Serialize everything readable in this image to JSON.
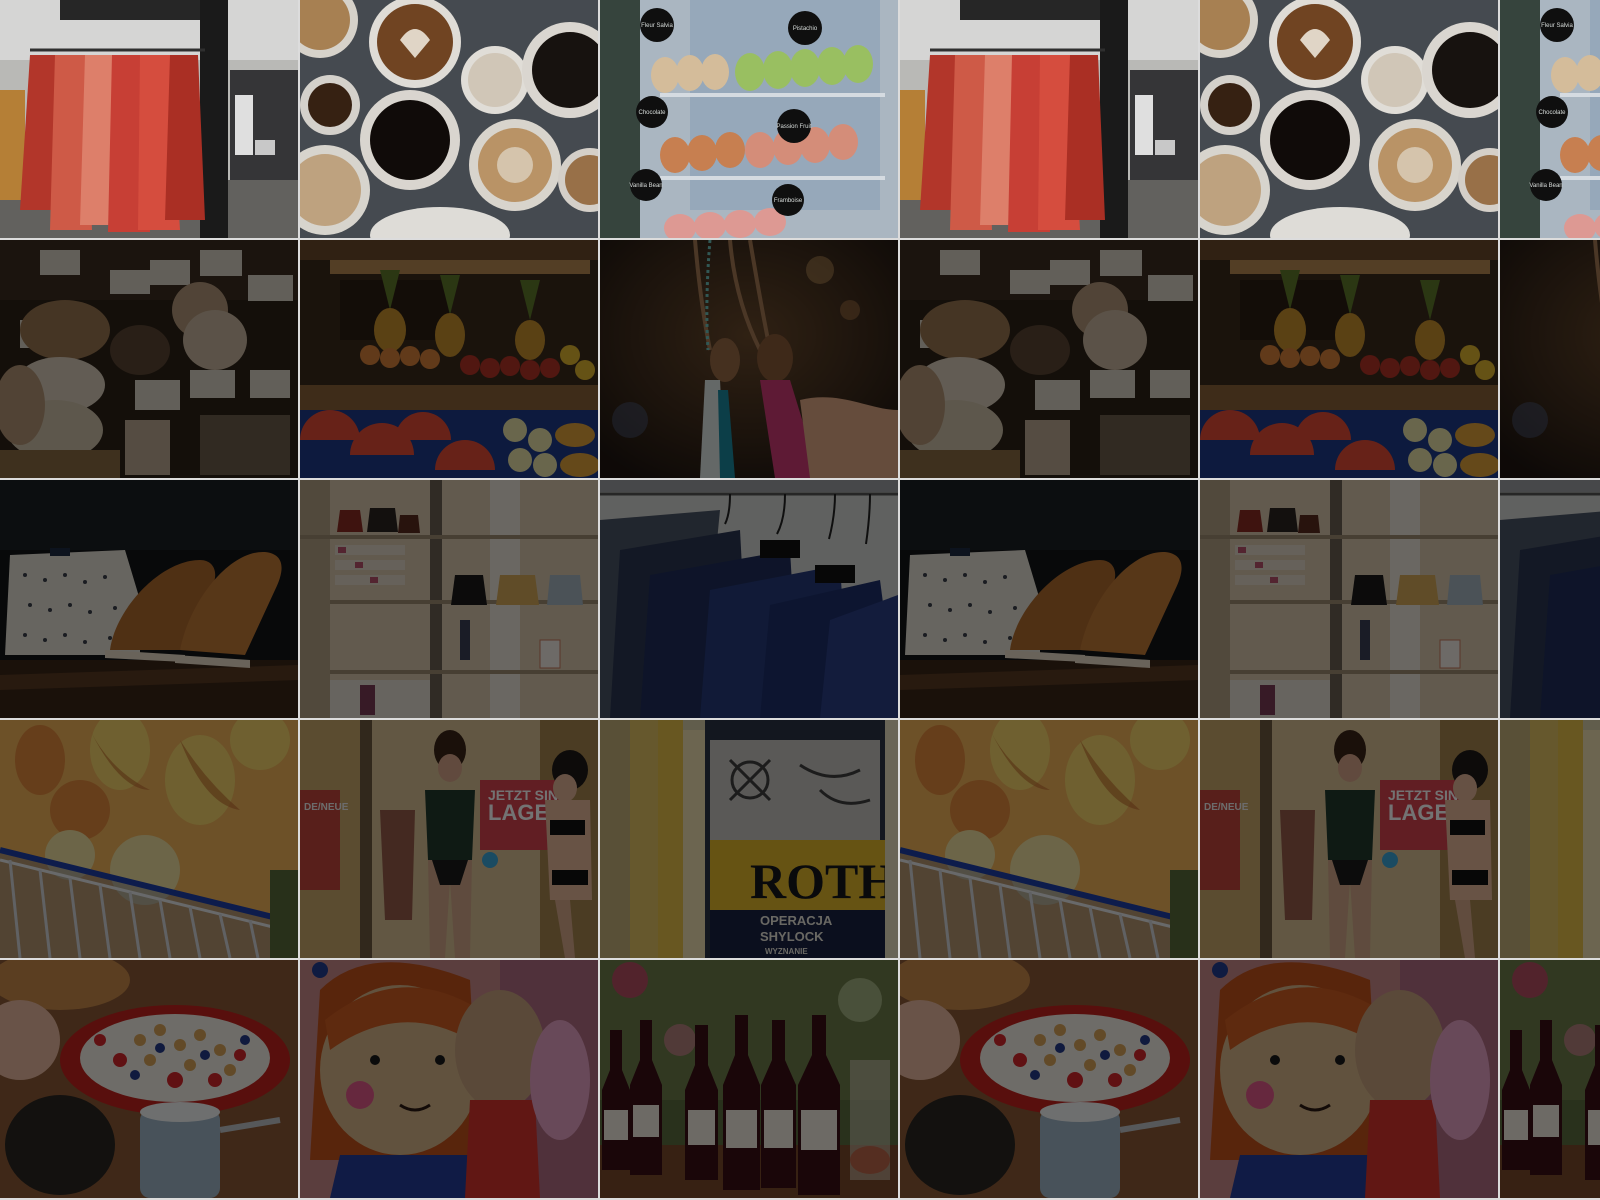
{
  "book_cover": {
    "author": "ROTH",
    "title_line1": "OPERACJA",
    "title_line2": "SHYLOCK",
    "publisher": "WYZNANIE"
  },
  "shop_poster": {
    "line1": "JETZT SIND",
    "line2": "LAGE",
    "line3": "DE/NEUE"
  },
  "macaron_signs": [
    "Fleur Salvia",
    "Pistachio",
    "Chocolate",
    "Passion Fruit",
    "Vanilla Bean",
    "Framboise"
  ],
  "tiles": [
    {
      "row": 0,
      "col": 0,
      "kind": "clothing-rack"
    },
    {
      "row": 0,
      "col": 1,
      "kind": "coffee-cups"
    },
    {
      "row": 0,
      "col": 2,
      "kind": "macarons"
    },
    {
      "row": 0,
      "col": 3,
      "kind": "clothing-rack"
    },
    {
      "row": 0,
      "col": 4,
      "kind": "coffee-cups"
    },
    {
      "row": 0,
      "col": 5,
      "kind": "macarons"
    },
    {
      "row": 1,
      "col": 0,
      "kind": "bread"
    },
    {
      "row": 1,
      "col": 1,
      "kind": "fruit-stand"
    },
    {
      "row": 1,
      "col": 2,
      "kind": "tassels"
    },
    {
      "row": 1,
      "col": 3,
      "kind": "bread"
    },
    {
      "row": 1,
      "col": 4,
      "kind": "fruit-stand"
    },
    {
      "row": 1,
      "col": 5,
      "kind": "tassels"
    },
    {
      "row": 2,
      "col": 0,
      "kind": "shoes"
    },
    {
      "row": 2,
      "col": 1,
      "kind": "bag-shelves"
    },
    {
      "row": 2,
      "col": 2,
      "kind": "suits"
    },
    {
      "row": 2,
      "col": 3,
      "kind": "shoes"
    },
    {
      "row": 2,
      "col": 4,
      "kind": "bag-shelves"
    },
    {
      "row": 2,
      "col": 5,
      "kind": "suits"
    },
    {
      "row": 3,
      "col": 0,
      "kind": "pasta-basket"
    },
    {
      "row": 3,
      "col": 1,
      "kind": "lingerie-window"
    },
    {
      "row": 3,
      "col": 2,
      "kind": "books"
    },
    {
      "row": 3,
      "col": 3,
      "kind": "pasta-basket"
    },
    {
      "row": 3,
      "col": 4,
      "kind": "lingerie-window"
    },
    {
      "row": 3,
      "col": 5,
      "kind": "books"
    },
    {
      "row": 4,
      "col": 0,
      "kind": "breakfast-bowl"
    },
    {
      "row": 4,
      "col": 1,
      "kind": "crochet-doll"
    },
    {
      "row": 4,
      "col": 2,
      "kind": "wine-bottles"
    },
    {
      "row": 4,
      "col": 3,
      "kind": "breakfast-bowl"
    },
    {
      "row": 4,
      "col": 4,
      "kind": "crochet-doll"
    },
    {
      "row": 4,
      "col": 5,
      "kind": "wine-bottles"
    }
  ],
  "colors": {
    "grid_gap": "#dcdcdc",
    "clothing_red": "#d8453a",
    "coffee_table": "#4b5157",
    "macaron_green": "#a7d06a",
    "suit_navy": "#1f2e5c"
  }
}
